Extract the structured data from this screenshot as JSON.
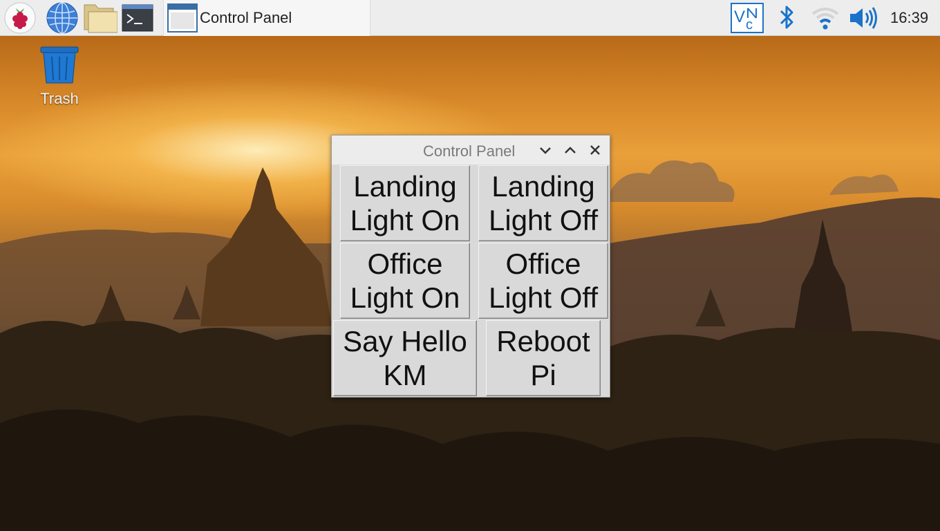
{
  "taskbar": {
    "launchers": [
      {
        "name": "raspberry-menu",
        "icon": "raspberry-icon"
      },
      {
        "name": "web-browser",
        "icon": "globe-icon"
      },
      {
        "name": "file-manager",
        "icon": "folder-icon"
      },
      {
        "name": "terminal",
        "icon": "terminal-icon"
      }
    ],
    "task_button_label": "Control Panel",
    "tray_icons": [
      "vnc-icon",
      "bluetooth-icon",
      "wifi-icon",
      "volume-icon"
    ],
    "clock": "16:39",
    "accent_color": "#1a73c9"
  },
  "desktop": {
    "trash_label": "Trash"
  },
  "window": {
    "title": "Control Panel",
    "controls": [
      "minimize",
      "maximize",
      "close"
    ],
    "buttons": [
      {
        "line1": "Landing",
        "line2": "Light On"
      },
      {
        "line1": "Landing",
        "line2": "Light Off"
      },
      {
        "line1": "Office",
        "line2": "Light On"
      },
      {
        "line1": "Office",
        "line2": "Light Off"
      },
      {
        "line1": "Say Hello",
        "line2": "KM"
      },
      {
        "line1": "Reboot",
        "line2": "Pi"
      }
    ]
  }
}
